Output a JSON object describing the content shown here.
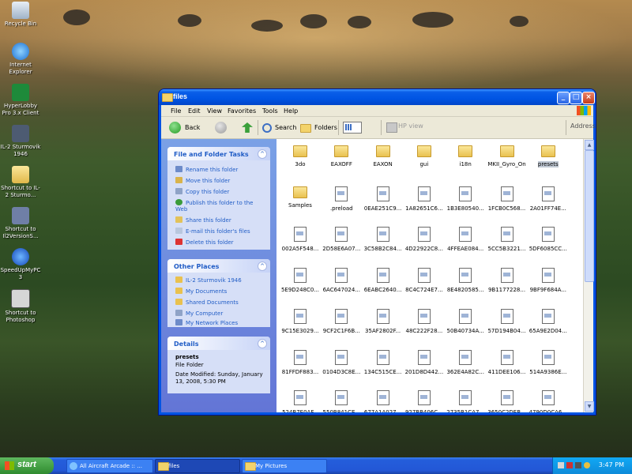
{
  "desktop": {
    "icons": [
      {
        "label": "Recycle Bin",
        "icon": "recycle-bin-icon"
      },
      {
        "label": "Internet Explorer",
        "icon": "ie-icon"
      },
      {
        "label": "HyperLobby Pro 3.x Client",
        "icon": "hyperlobby-icon"
      },
      {
        "label": "IL-2 Sturmovik 1946",
        "icon": "il2-icon"
      },
      {
        "label": "Shortcut to IL-2 Sturmo...",
        "icon": "folder-shortcut-icon"
      },
      {
        "label": "Shortcut to Il2VersionS...",
        "icon": "tool-shortcut-icon"
      },
      {
        "label": "SpeedUpMyPC 3",
        "icon": "speedup-icon"
      },
      {
        "label": "Shortcut to Photoshop",
        "icon": "photoshop-icon"
      }
    ]
  },
  "window": {
    "title": "files",
    "menu": [
      "File",
      "Edit",
      "View",
      "Favorites",
      "Tools",
      "Help"
    ],
    "toolbar": {
      "back": "Back",
      "search": "Search",
      "folders": "Folders",
      "hpview": "HP view",
      "address": "Address"
    }
  },
  "tasks": {
    "file_folder": {
      "title": "File and Folder Tasks",
      "items": [
        "Rename this folder",
        "Move this folder",
        "Copy this folder",
        "Publish this folder to the Web",
        "Share this folder",
        "E-mail this folder's files",
        "Delete this folder"
      ]
    },
    "other_places": {
      "title": "Other Places",
      "items": [
        "IL-2 Sturmovik 1946",
        "My Documents",
        "Shared Documents",
        "My Computer",
        "My Network Places"
      ]
    },
    "details": {
      "title": "Details",
      "name": "presets",
      "type": "File Folder",
      "modified": "Date Modified: Sunday, January 13, 2008, 5:30 PM"
    }
  },
  "files": {
    "items": [
      {
        "name": "3do",
        "kind": "folder"
      },
      {
        "name": "EAXOFF",
        "kind": "folder"
      },
      {
        "name": "EAXON",
        "kind": "folder"
      },
      {
        "name": "gui",
        "kind": "folder"
      },
      {
        "name": "i18n",
        "kind": "folder"
      },
      {
        "name": "MKII_Gyro_On",
        "kind": "folder"
      },
      {
        "name": "presets",
        "kind": "folder",
        "selected": true
      },
      {
        "name": "Samples",
        "kind": "folder"
      },
      {
        "name": ".preload",
        "kind": "file"
      },
      {
        "name": "0EAE251C9...",
        "kind": "file"
      },
      {
        "name": "1A82651C6...",
        "kind": "file"
      },
      {
        "name": "1B3E80540...",
        "kind": "file"
      },
      {
        "name": "1FCB0C568...",
        "kind": "file"
      },
      {
        "name": "2A01FF74E...",
        "kind": "file"
      },
      {
        "name": "002A5F548...",
        "kind": "file"
      },
      {
        "name": "2D58E6A07...",
        "kind": "file"
      },
      {
        "name": "3C58B2C84...",
        "kind": "file"
      },
      {
        "name": "4D22922C8...",
        "kind": "file"
      },
      {
        "name": "4FFEAE084...",
        "kind": "file"
      },
      {
        "name": "5CC5B3221...",
        "kind": "file"
      },
      {
        "name": "5DF6085CC...",
        "kind": "file"
      },
      {
        "name": "5E9D248C0...",
        "kind": "file"
      },
      {
        "name": "6AC647024...",
        "kind": "file"
      },
      {
        "name": "6EABC2640...",
        "kind": "file"
      },
      {
        "name": "8C4C724E7...",
        "kind": "file"
      },
      {
        "name": "8E4820585...",
        "kind": "file"
      },
      {
        "name": "9B1177228...",
        "kind": "file"
      },
      {
        "name": "9BF9F684A...",
        "kind": "file"
      },
      {
        "name": "9C15E3029...",
        "kind": "file"
      },
      {
        "name": "9CF2C1F6B...",
        "kind": "file"
      },
      {
        "name": "35AF2802F...",
        "kind": "file"
      },
      {
        "name": "48C222F28...",
        "kind": "file"
      },
      {
        "name": "50B40734A...",
        "kind": "file"
      },
      {
        "name": "57D194B04...",
        "kind": "file"
      },
      {
        "name": "65A9E2D04...",
        "kind": "file"
      },
      {
        "name": "81FFDF883...",
        "kind": "file"
      },
      {
        "name": "0104D3C8E...",
        "kind": "file"
      },
      {
        "name": "134C515CE...",
        "kind": "file"
      },
      {
        "name": "201D8D442...",
        "kind": "file"
      },
      {
        "name": "362E4A82C...",
        "kind": "file"
      },
      {
        "name": "411DEE106...",
        "kind": "file"
      },
      {
        "name": "514A9386E...",
        "kind": "file"
      },
      {
        "name": "524B7E0AF...",
        "kind": "file"
      },
      {
        "name": "550B841CE...",
        "kind": "file"
      },
      {
        "name": "677A1A027...",
        "kind": "file"
      },
      {
        "name": "927BB406C...",
        "kind": "file"
      },
      {
        "name": "2735B1CA7...",
        "kind": "file"
      },
      {
        "name": "3650C2DEB...",
        "kind": "file"
      },
      {
        "name": "4790D0CA6...",
        "kind": "file"
      }
    ]
  },
  "taskbar": {
    "start": "start",
    "buttons": [
      {
        "label": "All Aircraft Arcade :: ...",
        "active": false
      },
      {
        "label": "files",
        "active": true
      },
      {
        "label": "My Pictures",
        "active": false
      }
    ],
    "clock": "3:47 PM"
  }
}
